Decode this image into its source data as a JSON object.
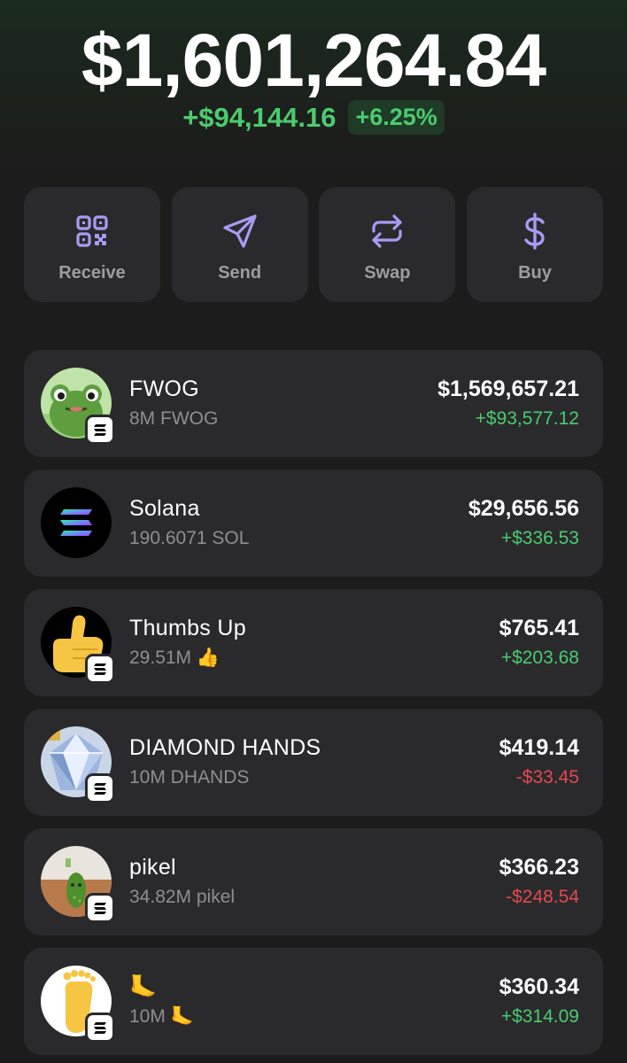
{
  "portfolio": {
    "balance": "$1,601,264.84",
    "change_amount": "+$94,144.16",
    "change_percent": "+6.25%"
  },
  "actions": [
    {
      "label": "Receive",
      "icon": "qr-code-icon"
    },
    {
      "label": "Send",
      "icon": "send-icon"
    },
    {
      "label": "Swap",
      "icon": "swap-icon"
    },
    {
      "label": "Buy",
      "icon": "dollar-icon"
    }
  ],
  "tokens": [
    {
      "name": "FWOG",
      "amount": "8M FWOG",
      "value": "$1,569,657.21",
      "change": "+$93,577.12",
      "direction": "up",
      "icon": "frog-avatar"
    },
    {
      "name": "Solana",
      "amount": "190.6071 SOL",
      "value": "$29,656.56",
      "change": "+$336.53",
      "direction": "up",
      "icon": "solana-logo"
    },
    {
      "name": "Thumbs Up",
      "amount": "29.51M 👍",
      "value": "$765.41",
      "change": "+$203.68",
      "direction": "up",
      "icon": "thumbs-up-avatar"
    },
    {
      "name": "DIAMOND HANDS",
      "amount": "10M DHANDS",
      "value": "$419.14",
      "change": "-$33.45",
      "direction": "down",
      "icon": "diamond-avatar"
    },
    {
      "name": "pikel",
      "amount": "34.82M pikel",
      "value": "$366.23",
      "change": "-$248.54",
      "direction": "down",
      "icon": "pickle-avatar"
    },
    {
      "name": "🦶",
      "amount": "10M 🦶",
      "value": "$360.34",
      "change": "+$314.09",
      "direction": "up",
      "icon": "foot-avatar"
    }
  ],
  "colors": {
    "accent": "#a99bf4",
    "positive": "#4ccb6f",
    "negative": "#e5484d",
    "card": "#2a2a2c",
    "background": "#1c1c1c"
  }
}
